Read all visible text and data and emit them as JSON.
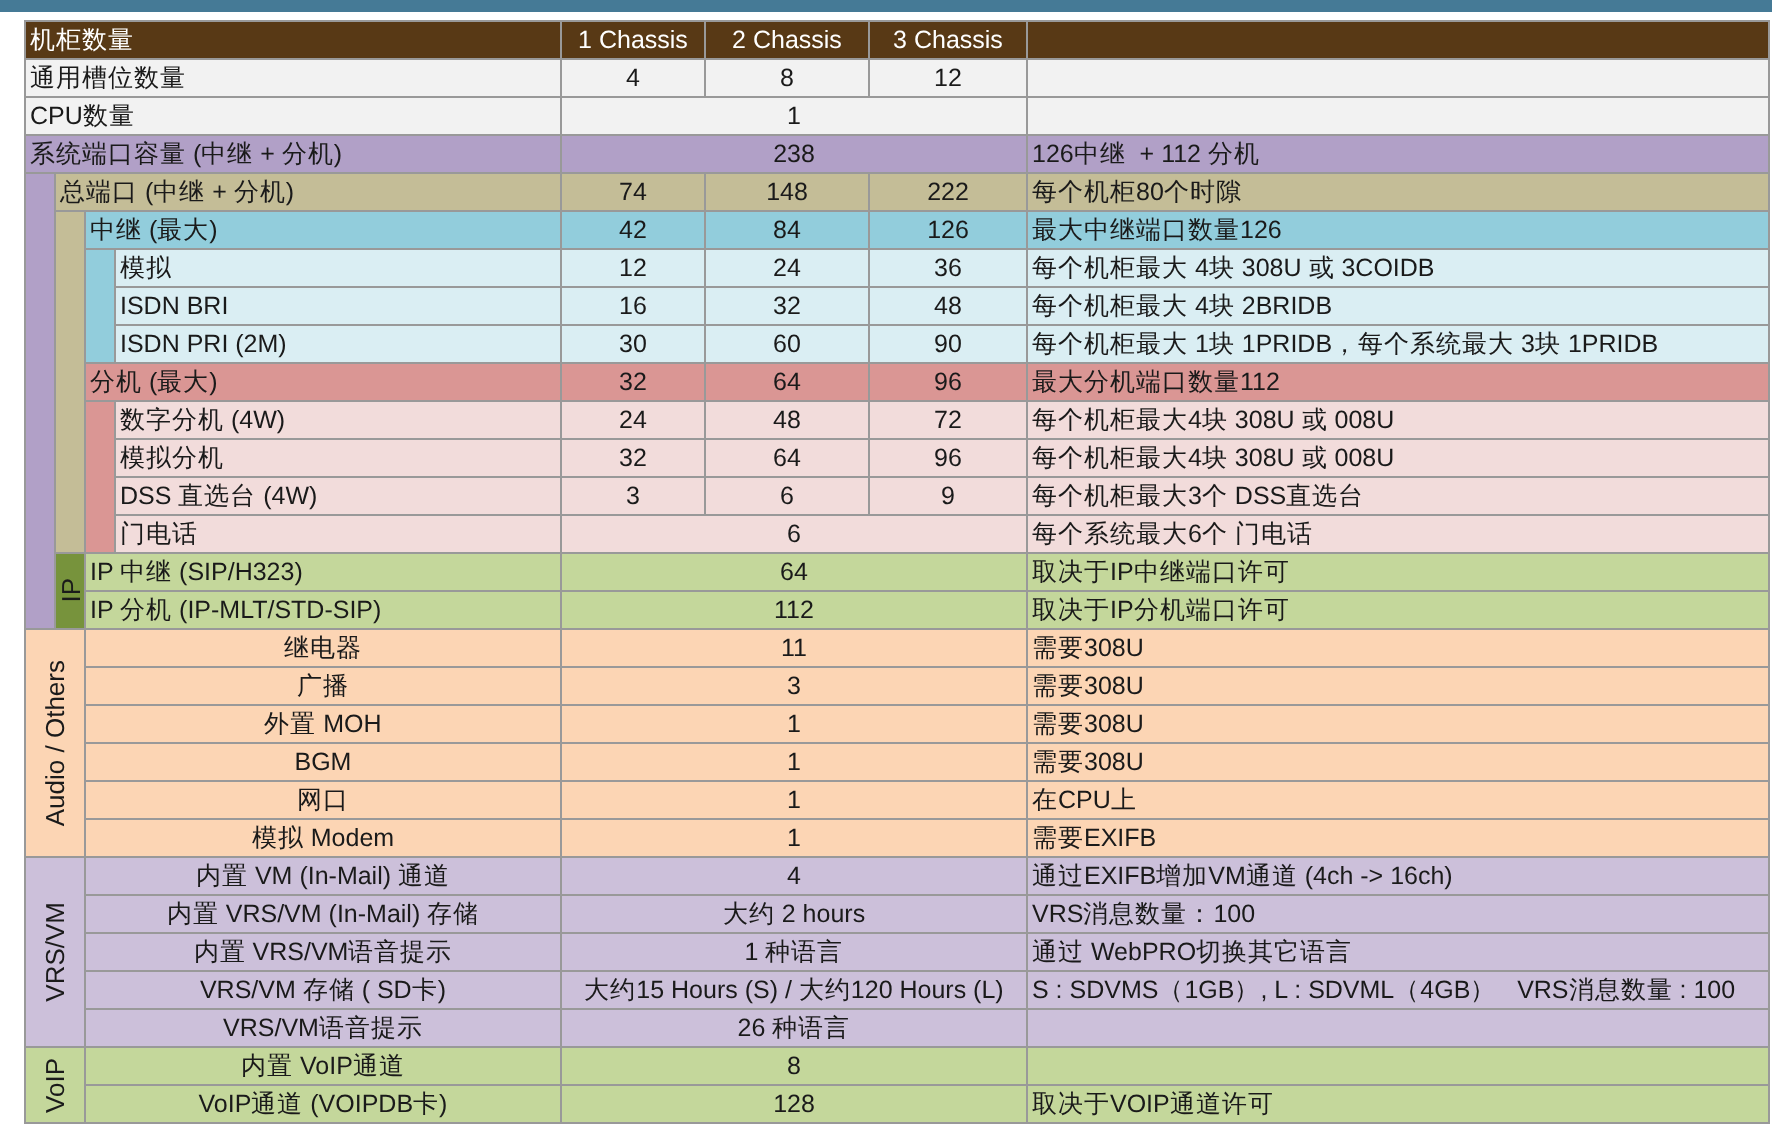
{
  "header": {
    "label": "机柜数量",
    "columns": [
      "1 Chassis",
      "2 Chassis",
      "3 Chassis"
    ]
  },
  "rows": [
    {
      "kind": "row",
      "label": "通用槽位数量",
      "values": [
        "4",
        "8",
        "12"
      ],
      "color": "#f2f2f2"
    },
    {
      "kind": "row",
      "label": "CPU数量",
      "value": "1",
      "color": "#f2f2f2"
    },
    {
      "kind": "row",
      "label": "系统端口容量 (中继 + 分机)",
      "value": "238",
      "note": "126中继  + 112 分机",
      "color": "#b1a0c7",
      "children": [
        {
          "kind": "row",
          "label": "总端口 (中继 + 分机)",
          "values": [
            "74",
            "148",
            "222"
          ],
          "note": "每个机柜80个时隙",
          "color": "#c4bd97",
          "children": [
            {
              "kind": "row",
              "label": "中继 (最大)",
              "values": [
                "42",
                "84",
                "126"
              ],
              "note": "最大中继端口数量126",
              "color": "#92cddc",
              "children": [
                {
                  "kind": "row",
                  "label": "模拟",
                  "values": [
                    "12",
                    "24",
                    "36"
                  ],
                  "note": "每个机柜最大 4块 308U 或 3COIDB",
                  "color": "#daeef3"
                },
                {
                  "kind": "row",
                  "label": "ISDN BRI",
                  "values": [
                    "16",
                    "32",
                    "48"
                  ],
                  "note": "每个机柜最大 4块 2BRIDB",
                  "color": "#daeef3"
                },
                {
                  "kind": "row",
                  "label": "ISDN PRI (2M)",
                  "values": [
                    "30",
                    "60",
                    "90"
                  ],
                  "note": "每个机柜最大 1块 1PRIDB，每个系统最大 3块 1PRIDB",
                  "color": "#daeef3"
                }
              ]
            },
            {
              "kind": "row",
              "label": "分机 (最大)",
              "values": [
                "32",
                "64",
                "96"
              ],
              "note": "最大分机端口数量112",
              "color": "#da9694",
              "children": [
                {
                  "kind": "row",
                  "label": "数字分机 (4W)",
                  "values": [
                    "24",
                    "48",
                    "72"
                  ],
                  "note": "每个机柜最大4块 308U 或 008U",
                  "color": "#f2dcdb"
                },
                {
                  "kind": "row",
                  "label": "模拟分机",
                  "values": [
                    "32",
                    "64",
                    "96"
                  ],
                  "note": "每个机柜最大4块 308U 或 008U",
                  "color": "#f2dcdb"
                },
                {
                  "kind": "row",
                  "label": "DSS 直选台 (4W)",
                  "values": [
                    "3",
                    "6",
                    "9"
                  ],
                  "note": "每个机柜最大3个 DSS直选台",
                  "color": "#f2dcdb"
                },
                {
                  "kind": "row",
                  "label": "门电话",
                  "value": "6",
                  "note": "每个系统最大6个 门电话",
                  "color": "#f2dcdb"
                }
              ]
            }
          ]
        },
        {
          "kind": "group",
          "title": "IP",
          "color": "#77933c",
          "children": [
            {
              "kind": "row",
              "label": "IP 中继 (SIP/H323)",
              "value": "64",
              "note": "取决于IP中继端口许可",
              "color": "#c4d79b"
            },
            {
              "kind": "row",
              "label": "IP 分机 (IP-MLT/STD-SIP)",
              "value": "112",
              "note": "取决于IP分机端口许可",
              "color": "#c4d79b"
            }
          ]
        }
      ]
    },
    {
      "kind": "section",
      "title": "Audio / Others",
      "color": "#fcd5b4",
      "children": [
        {
          "kind": "row",
          "label": "继电器",
          "value": "11",
          "note": "需要308U",
          "color": "#fcd5b4"
        },
        {
          "kind": "row",
          "label": "广播",
          "value": "3",
          "note": "需要308U",
          "color": "#fcd5b4"
        },
        {
          "kind": "row",
          "label": "外置 MOH",
          "value": "1",
          "note": "需要308U",
          "color": "#fcd5b4"
        },
        {
          "kind": "row",
          "label": "BGM",
          "value": "1",
          "note": "需要308U",
          "color": "#fcd5b4"
        },
        {
          "kind": "row",
          "label": "网口",
          "value": "1",
          "note": "在CPU上",
          "color": "#fcd5b4"
        },
        {
          "kind": "row",
          "label": "模拟 Modem",
          "value": "1",
          "note": "需要EXIFB",
          "color": "#fcd5b4"
        }
      ]
    },
    {
      "kind": "section",
      "title": "VRS/VM",
      "color": "#ccc0da",
      "children": [
        {
          "kind": "row",
          "label": "内置 VM (In-Mail) 通道",
          "value": "4",
          "note": "通过EXIFB增加VM通道 (4ch -> 16ch)",
          "color": "#ccc0da"
        },
        {
          "kind": "row",
          "label": "内置 VRS/VM (In-Mail) 存储",
          "value": "大约 2 hours",
          "note": "VRS消息数量：100",
          "color": "#ccc0da"
        },
        {
          "kind": "row",
          "label": "内置 VRS/VM语音提示",
          "value": "1 种语言",
          "note": "通过 WebPRO切换其它语言",
          "color": "#ccc0da"
        },
        {
          "kind": "row",
          "label": "VRS/VM 存储 ( SD卡)",
          "value": "大约15 Hours (S) / 大约120 Hours (L)",
          "note": "S : SDVMS（1GB）, L : SDVML（4GB）   VRS消息数量 : 100",
          "color": "#ccc0da"
        },
        {
          "kind": "row",
          "label": "VRS/VM语音提示",
          "value": "26 种语言",
          "color": "#ccc0da"
        }
      ]
    },
    {
      "kind": "section",
      "title": "VoIP",
      "color": "#c4d79b",
      "children": [
        {
          "kind": "row",
          "label": "内置 VoIP通道",
          "value": "8",
          "color": "#c4d79b"
        },
        {
          "kind": "row",
          "label": "VoIP通道 (VOIPDB卡)",
          "value": "128",
          "note": "取决于VOIP通道许可",
          "color": "#c4d79b"
        }
      ]
    }
  ]
}
